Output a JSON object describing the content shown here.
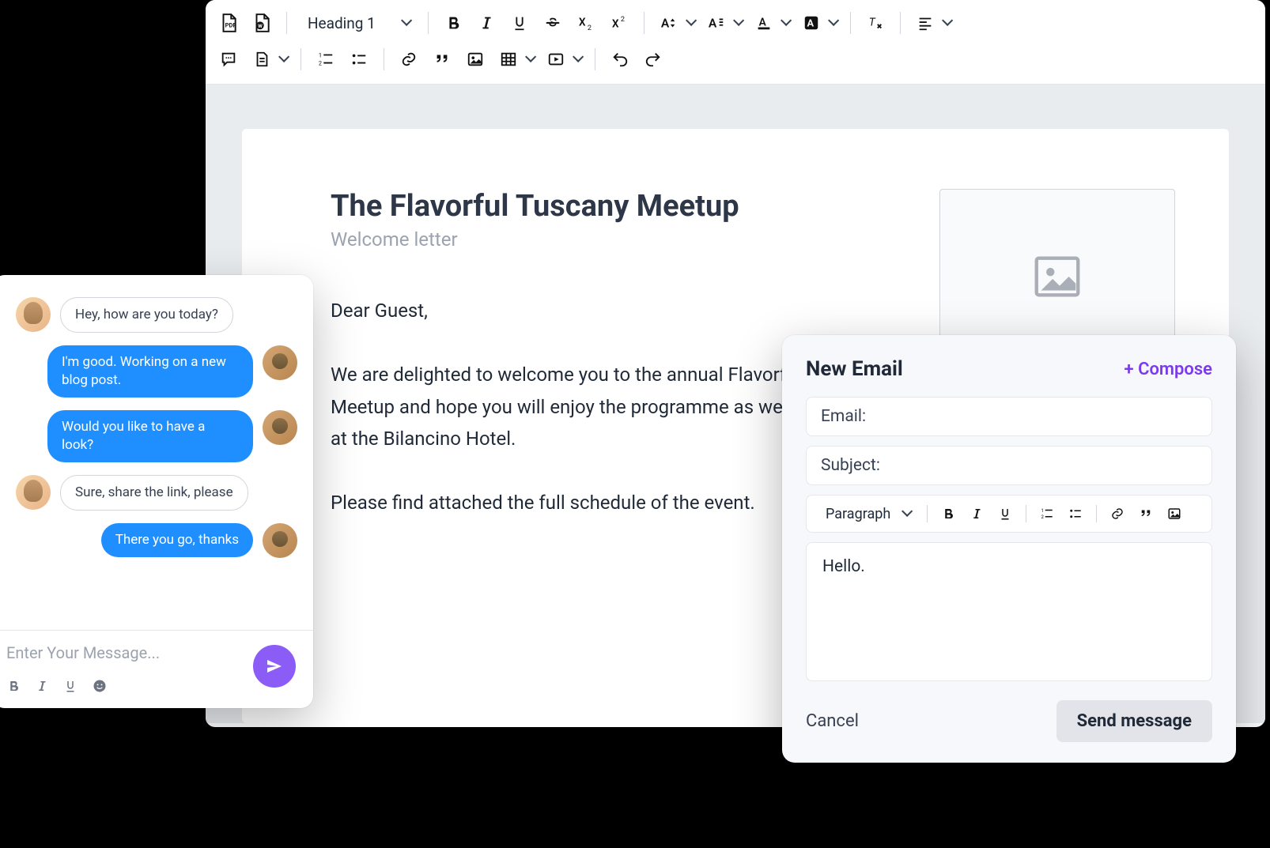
{
  "editor": {
    "heading_select": "Heading 1",
    "document": {
      "title": "The Flavorful Tuscany Meetup",
      "subtitle": "Welcome letter",
      "greeting": "Dear Guest,",
      "para1": "We are delighted to welcome you to the annual Flavorful Tuscany Meetup and hope you will enjoy the programme as well as your stay at the Bilancino Hotel.",
      "para2": "Please find attached the full schedule of the event."
    }
  },
  "chat": {
    "messages": [
      {
        "side": "left",
        "avatar": "a1",
        "text": "Hey, how are you today?"
      },
      {
        "side": "right",
        "avatar": "a2",
        "text": "I'm good. Working on a new blog post."
      },
      {
        "side": "right",
        "avatar": "a2",
        "text": "Would you like to have a look?"
      },
      {
        "side": "left",
        "avatar": "a1",
        "text": "Sure, share the link, please"
      },
      {
        "side": "right",
        "avatar": "a2",
        "text": "There you go, thanks"
      }
    ],
    "input_placeholder": "Enter Your Message..."
  },
  "email": {
    "title": "New Email",
    "compose": "+ Compose",
    "email_label": "Email:",
    "subject_label": "Subject:",
    "paragraph_select": "Paragraph",
    "body": "Hello.",
    "cancel": "Cancel",
    "send": "Send message"
  }
}
